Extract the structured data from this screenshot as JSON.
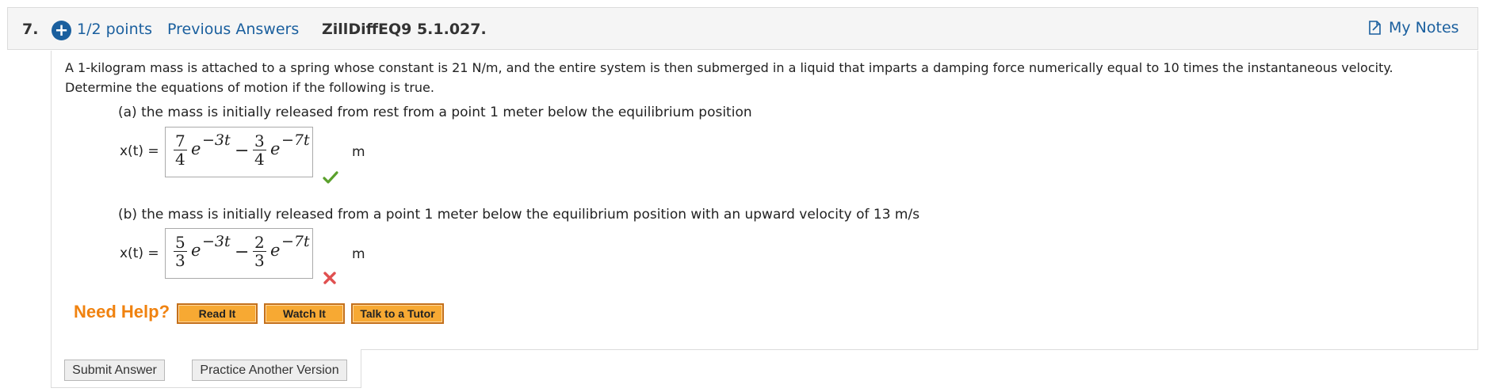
{
  "header": {
    "question_number": "7.",
    "points": "1/2 points",
    "previous_answers": "Previous Answers",
    "problem_code": "ZillDiffEQ9 5.1.027.",
    "my_notes": "My Notes"
  },
  "problem": {
    "intro_line1": "A 1-kilogram mass is attached to a spring whose constant is 21 N/m, and the entire system is then submerged in a liquid that imparts a damping force numerically equal to 10 times the instantaneous velocity.",
    "intro_line2": "Determine the equations of motion if the following is true.",
    "part_a": {
      "label": "(a) the mass is initially released from rest from a point 1 meter below the equilibrium position",
      "var_label": "x(t) =",
      "answer": {
        "coef1_num": "7",
        "coef1_den": "4",
        "exp1": "−3t",
        "coef2_num": "3",
        "coef2_den": "4",
        "exp2": "−7t",
        "e": "e",
        "minus": "−"
      },
      "unit": "m",
      "status": "correct"
    },
    "part_b": {
      "label": "(b) the mass is initially released from a point 1 meter below the equilibrium position with an upward velocity of 13 m/s",
      "var_label": "x(t) =",
      "answer": {
        "coef1_num": "5",
        "coef1_den": "3",
        "exp1": "−3t",
        "coef2_num": "2",
        "coef2_den": "3",
        "exp2": "−7t",
        "e": "e",
        "minus": "−"
      },
      "unit": "m",
      "status": "incorrect"
    }
  },
  "help": {
    "title": "Need Help?",
    "read_it": "Read It",
    "watch_it": "Watch It",
    "talk_tutor": "Talk to a Tutor"
  },
  "actions": {
    "submit": "Submit Answer",
    "practice": "Practice Another Version"
  },
  "colors": {
    "link": "#1a5f9e",
    "help_orange": "#f0820f",
    "correct_green": "#5aa02c",
    "incorrect_red": "#e05050"
  }
}
